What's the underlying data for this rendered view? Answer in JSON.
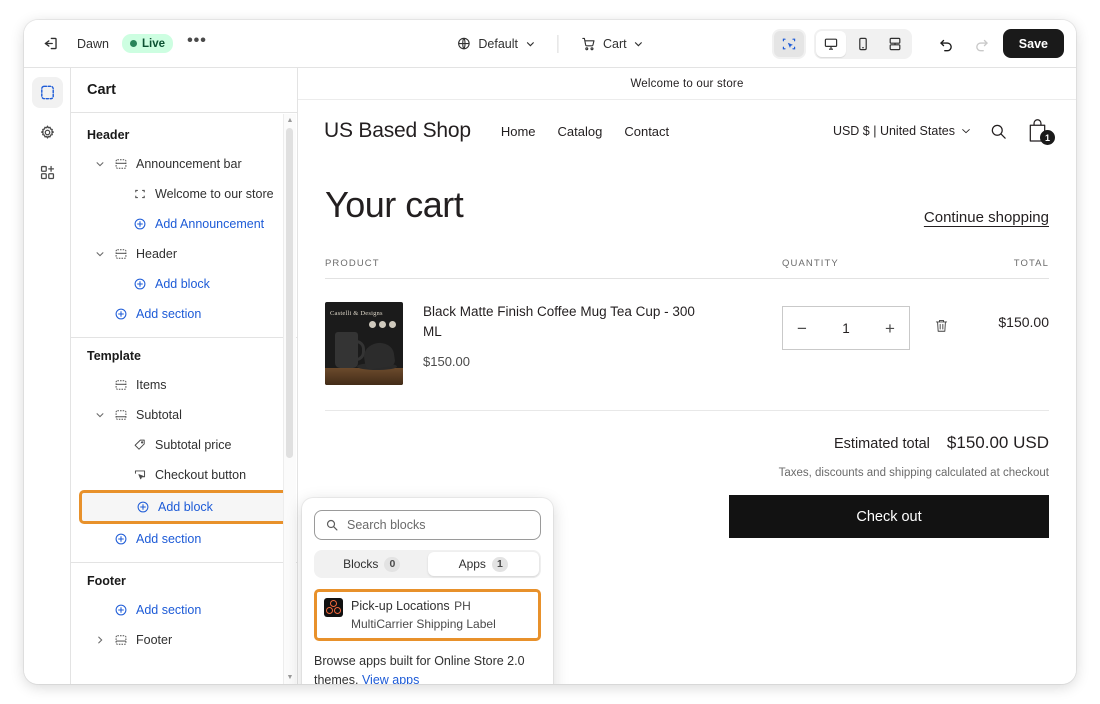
{
  "topbar": {
    "exit_icon": "exit-icon",
    "theme_name": "Dawn",
    "status_label": "Live",
    "more_label": "•••",
    "theme_selector": {
      "icon": "globe-icon",
      "label": "Default",
      "caret": "chevron-down-icon"
    },
    "page_selector": {
      "icon": "cart-icon",
      "label": "Cart",
      "caret": "chevron-down-icon"
    },
    "view_buttons": [
      {
        "name": "inspector-toggle",
        "icon": "select-pointer-icon",
        "active": true
      },
      {
        "name": "desktop-view",
        "icon": "desktop-icon",
        "active": true
      },
      {
        "name": "mobile-view",
        "icon": "mobile-icon",
        "active": false
      },
      {
        "name": "fullscreen-view",
        "icon": "fullscreen-icon",
        "active": false
      }
    ],
    "undo_label": "undo-icon",
    "redo_label": "redo-icon",
    "save_label": "Save"
  },
  "rail": {
    "items": [
      {
        "name": "sections",
        "icon": "sections-icon",
        "active": true
      },
      {
        "name": "settings",
        "icon": "gear-icon",
        "active": false
      },
      {
        "name": "apps",
        "icon": "apps-icon",
        "active": false
      }
    ]
  },
  "sidebar": {
    "title": "Cart",
    "groups": [
      {
        "label": "Header",
        "rows": [
          {
            "label": "Announcement bar",
            "icon": "section-icon",
            "caret": "chevron-down",
            "indent": 1,
            "link": false
          },
          {
            "label": "Welcome to our store",
            "icon": "block-icon",
            "caret": "",
            "indent": 2,
            "link": false
          },
          {
            "label": "Add Announcement",
            "icon": "plus-circle-icon",
            "caret": "",
            "indent": 2,
            "link": true
          },
          {
            "label": "Header",
            "icon": "section-icon",
            "caret": "chevron-down",
            "indent": 1,
            "link": false
          },
          {
            "label": "Add block",
            "icon": "plus-circle-icon",
            "caret": "",
            "indent": 2,
            "link": true
          },
          {
            "label": "Add section",
            "icon": "plus-circle-icon",
            "caret": "",
            "indent": 1,
            "link": true
          }
        ]
      },
      {
        "label": "Template",
        "rows": [
          {
            "label": "Items",
            "icon": "section-icon",
            "caret": "",
            "indent": 1,
            "link": false
          },
          {
            "label": "Subtotal",
            "icon": "subtotal-icon",
            "caret": "chevron-down",
            "indent": 1,
            "link": false
          },
          {
            "label": "Subtotal price",
            "icon": "price-tag-icon",
            "caret": "",
            "indent": 2,
            "link": false
          },
          {
            "label": "Checkout button",
            "icon": "button-cursor-icon",
            "caret": "",
            "indent": 2,
            "link": false
          },
          {
            "label": "Add block",
            "icon": "plus-circle-icon",
            "caret": "",
            "indent": 2,
            "link": true,
            "highlighted": true
          },
          {
            "label": "Add section",
            "icon": "plus-circle-icon",
            "caret": "",
            "indent": 1,
            "link": true
          }
        ]
      },
      {
        "label": "Footer",
        "rows": [
          {
            "label": "Add section",
            "icon": "plus-circle-icon",
            "caret": "",
            "indent": 1,
            "link": true
          },
          {
            "label": "Footer",
            "icon": "footer-icon",
            "caret": "chevron-right",
            "indent": 1,
            "link": false
          }
        ]
      }
    ]
  },
  "popover": {
    "search_placeholder": "Search blocks",
    "search_value": "",
    "tabs": [
      {
        "label": "Blocks",
        "count": "0",
        "active": false
      },
      {
        "label": "Apps",
        "count": "1",
        "active": true
      }
    ],
    "app": {
      "name": "Pick-up Locations",
      "subtitle": "PH MultiCarrier Shipping Label",
      "icon": "app-logo-icon"
    },
    "browse_text": "Browse apps built for Online Store 2.0 themes. ",
    "browse_link": "View apps"
  },
  "preview": {
    "announcement": "Welcome to our store",
    "store_name": "US Based Shop",
    "nav": [
      "Home",
      "Catalog",
      "Contact"
    ],
    "locale": "USD $ | United States",
    "search_icon": "search-icon",
    "cart_icon": "cart-bag-icon",
    "cart_count": "1",
    "cart": {
      "heading": "Your cart",
      "continue_shopping": "Continue shopping",
      "columns": {
        "product": "PRODUCT",
        "quantity": "QUANTITY",
        "total": "TOTAL"
      },
      "items": [
        {
          "title": "Black Matte Finish Coffee Mug Tea Cup - 300 ML",
          "price": "$150.00",
          "quantity": "1",
          "total": "$150.00",
          "minus": "−",
          "plus": "+",
          "remove_icon": "trash-icon"
        }
      ],
      "estimated_total_label": "Estimated total",
      "estimated_total_value": "$150.00 USD",
      "tax_note": "Taxes, discounts and shipping calculated at checkout",
      "checkout_label": "Check out"
    }
  },
  "colors": {
    "accent_blue": "#1d5bd7",
    "highlight_orange": "#e8912b",
    "live_green_bg": "#cdfee1",
    "live_green_text": "#0c5132"
  }
}
